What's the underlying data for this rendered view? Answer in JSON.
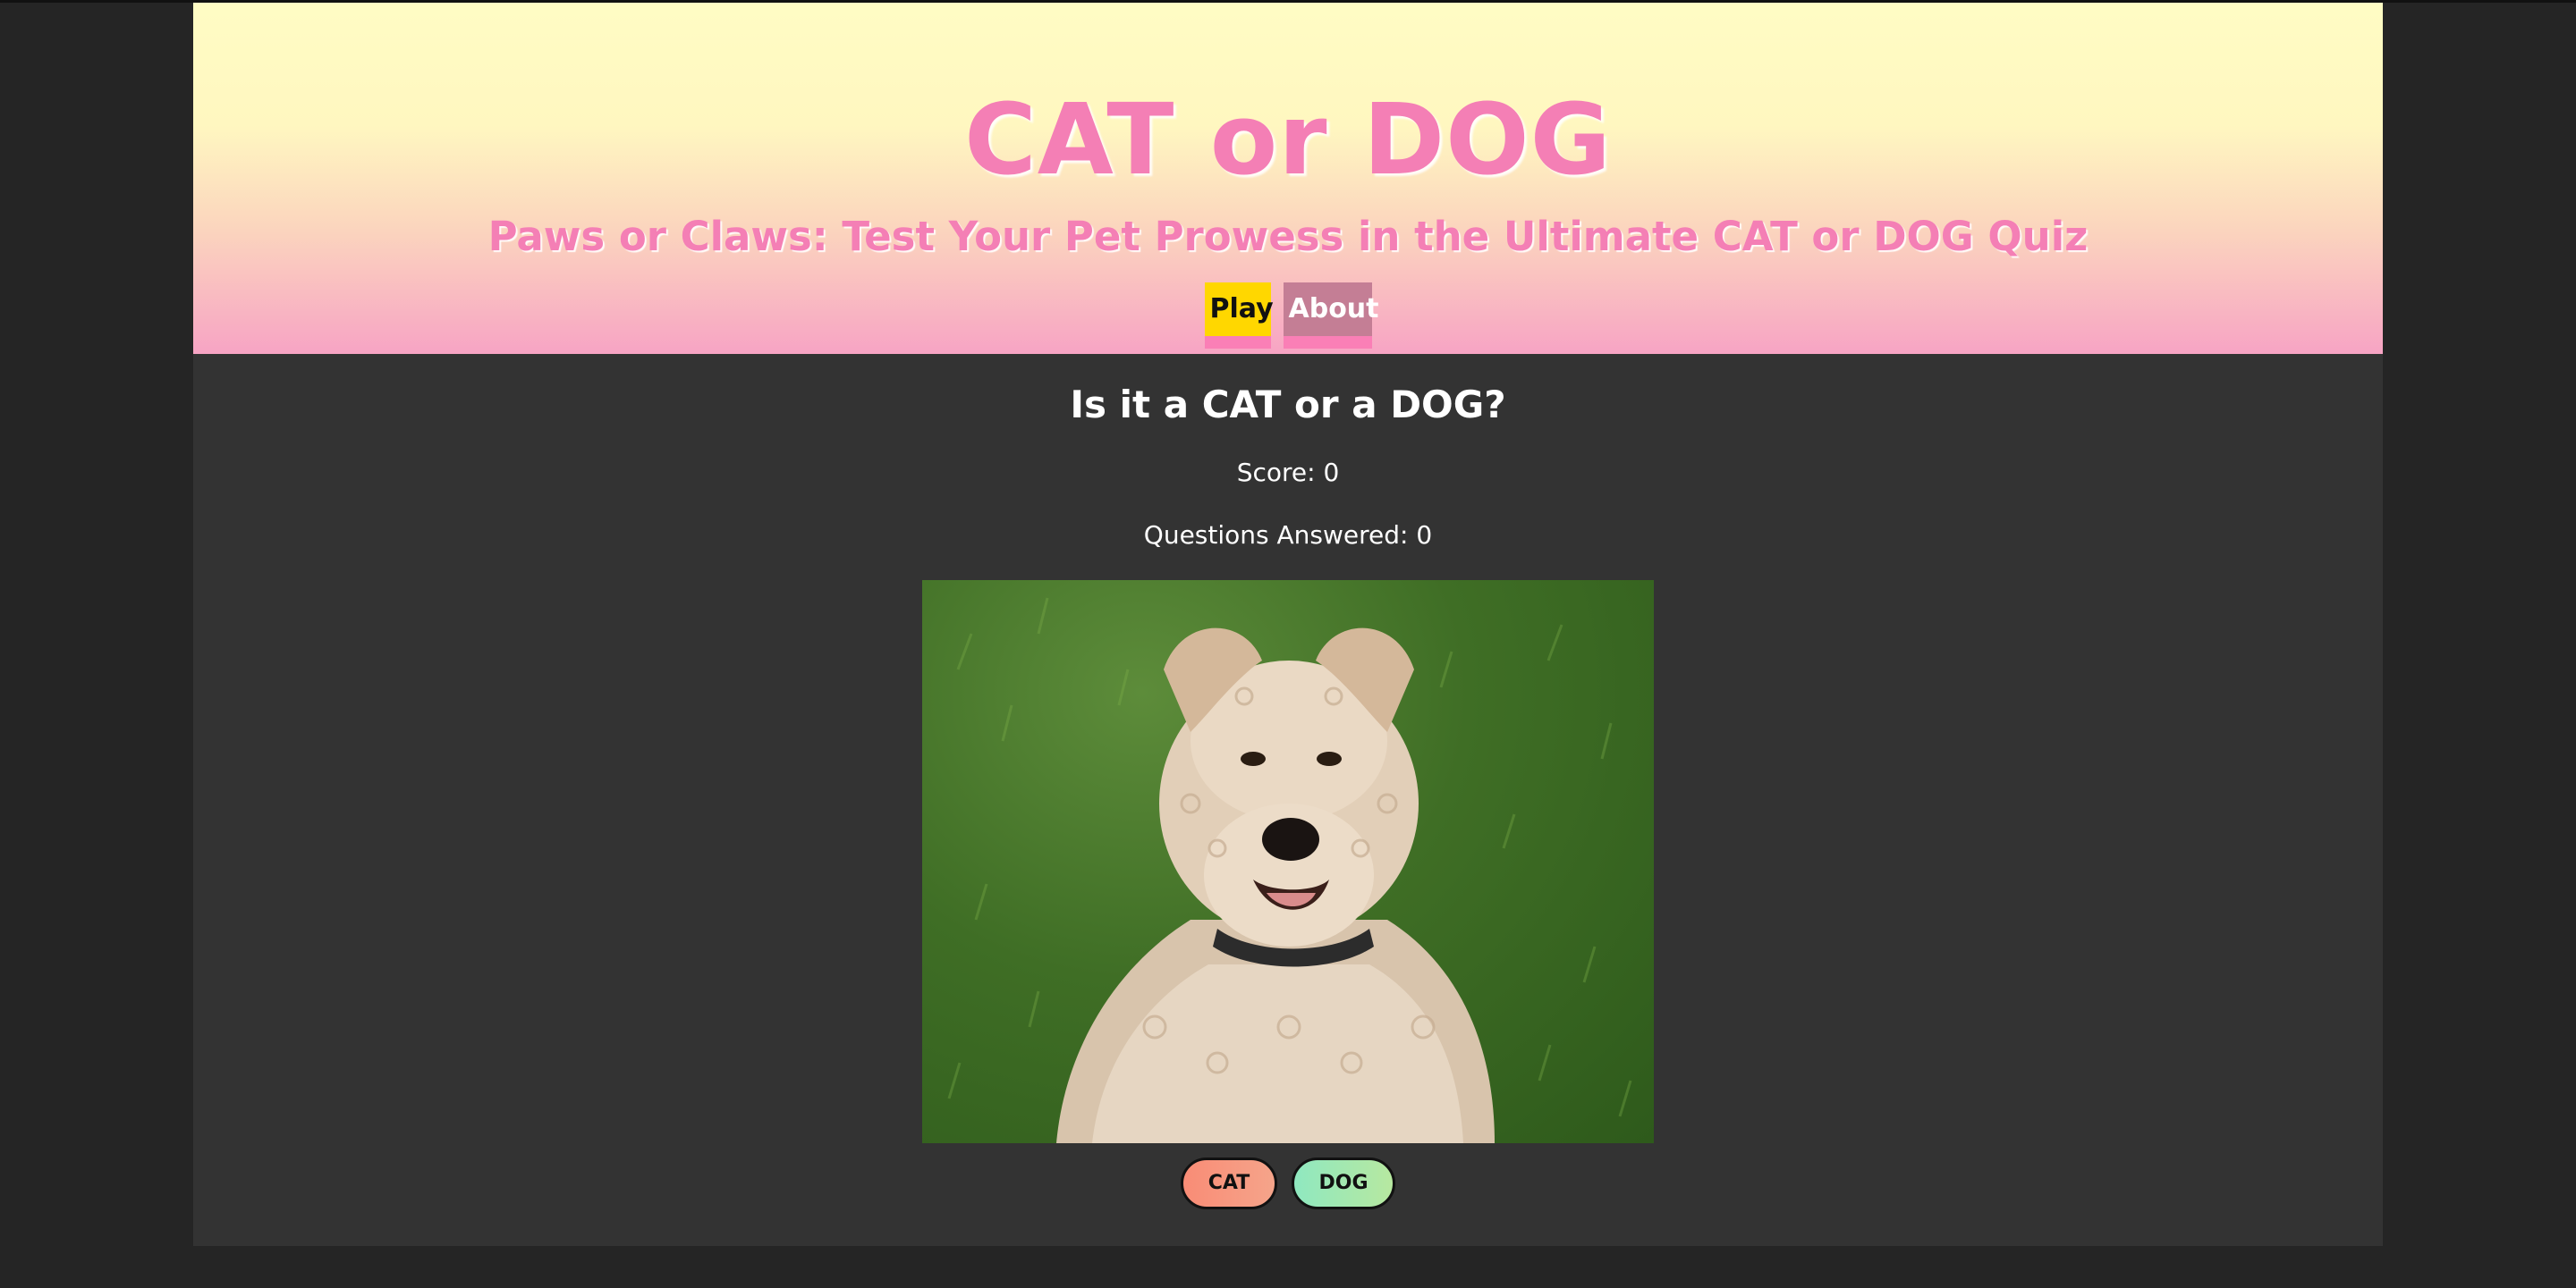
{
  "header": {
    "title": "CAT or DOG",
    "subtitle": "Paws or Claws: Test Your Pet Prowess in the Ultimate CAT or DOG Quiz",
    "nav": [
      {
        "label": "Play"
      },
      {
        "label": "About"
      }
    ]
  },
  "quiz": {
    "question": "Is it a CAT or a DOG?",
    "score_text": "Score: 0",
    "answered_text": "Questions Answered: 0",
    "image_subject": "dog-photo",
    "answers": [
      {
        "label": "CAT"
      },
      {
        "label": "DOG"
      }
    ]
  },
  "colors": {
    "title": "#f47fb5",
    "play_button": "#ffd700",
    "about_button": "#c47e95",
    "cat_button": "#f98c76",
    "dog_button": "#8fe8c0",
    "body_background": "#333333"
  }
}
